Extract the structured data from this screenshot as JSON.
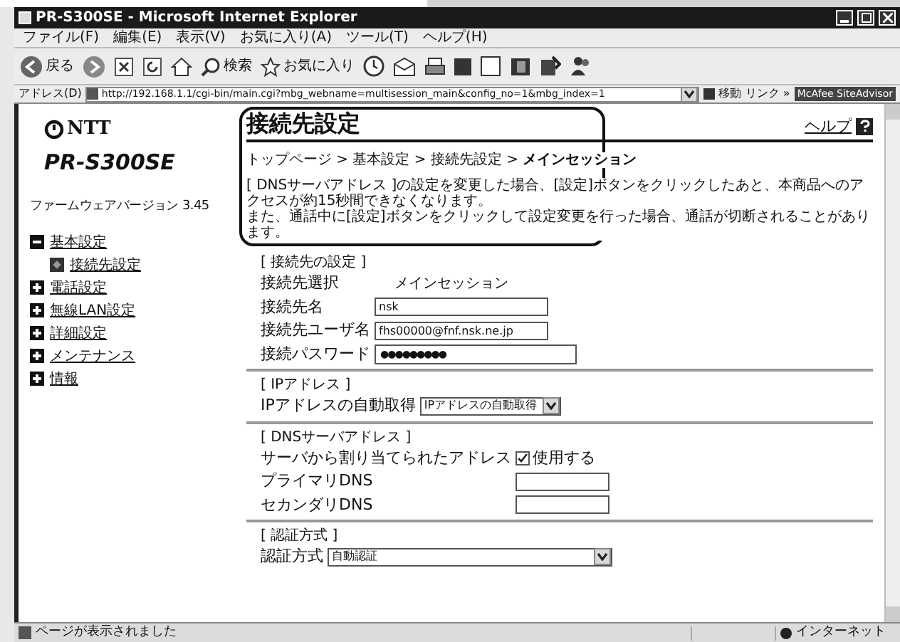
{
  "window": {
    "title": "PR-S300SE - Microsoft Internet Explorer"
  },
  "menu": [
    "ファイル(F)",
    "編集(E)",
    "表示(V)",
    "お気に入り(A)",
    "ツール(T)",
    "ヘルプ(H)"
  ],
  "toolbar": {
    "back": "戻る",
    "search": "検索",
    "favorites": "お気に入り"
  },
  "address_bar": {
    "label": "アドレス(D)",
    "url": "http://192.168.1.1/cgi-bin/main.cgi?mbg_webname=multisession_main&config_no=1&mbg_index=1",
    "go": "移動",
    "links": "リンク »",
    "addon": "McAfee SiteAdvisor"
  },
  "sidebar": {
    "brand": "NTT",
    "model": "PR-S300SE",
    "firmware": "ファームウェアバージョン 3.45",
    "items": [
      {
        "label": "基本設定",
        "expanded": true,
        "children": [
          {
            "label": "接続先設定"
          }
        ]
      },
      {
        "label": "電話設定",
        "expanded": false
      },
      {
        "label": "無線LAN設定",
        "expanded": false
      },
      {
        "label": "詳細設定",
        "expanded": false
      },
      {
        "label": "メンテナンス",
        "expanded": false
      },
      {
        "label": "情報",
        "expanded": false
      }
    ]
  },
  "page": {
    "title": "接続先設定",
    "help": "ヘルプ",
    "breadcrumb": "トップページ > 基本設定 > 接続先設定 > **メインセッション**",
    "notice": [
      "[ DNSサーバアドレス ]の設定を変更した場合、[設定]ボタンをクリックしたあと、本商品へのアクセスが約15秒間できなくなります。",
      "また、通話中に[設定]ボタンをクリックして設定変更を行った場合、通話が切断されることがあります。"
    ],
    "sections": [
      {
        "heading": "[ 接続先の設定 ]",
        "rows": [
          {
            "kind": "text",
            "label": "接続先選択",
            "value": "メインセッション"
          },
          {
            "kind": "input",
            "label": "接続先名",
            "value": "nsk"
          },
          {
            "kind": "input",
            "label": "接続先ユーザ名",
            "value": "fhs00000@fnf.nsk.ne.jp"
          },
          {
            "kind": "password",
            "label": "接続パスワード",
            "value": "●●●●●●●●●"
          }
        ]
      },
      {
        "heading": "[ IPアドレス ]",
        "rows": [
          {
            "kind": "select",
            "label": "IPアドレスの自動取得",
            "value": "IPアドレスの自動取得"
          }
        ]
      },
      {
        "heading": "[ DNSサーバアドレス ]",
        "rows": [
          {
            "kind": "checkbox",
            "label": "サーバから割り当てられたアドレス",
            "option": "使用する",
            "checked": true
          },
          {
            "kind": "ip",
            "label": "プライマリDNS"
          },
          {
            "kind": "ip",
            "label": "セカンダリDNS"
          }
        ]
      },
      {
        "heading": "[ 認証方式 ]",
        "rows": [
          {
            "kind": "wide_select",
            "label": "認証方式",
            "value": "自動認証"
          }
        ]
      }
    ]
  },
  "status_bar": {
    "text": "ページが表示されました",
    "zone": "インターネット"
  }
}
